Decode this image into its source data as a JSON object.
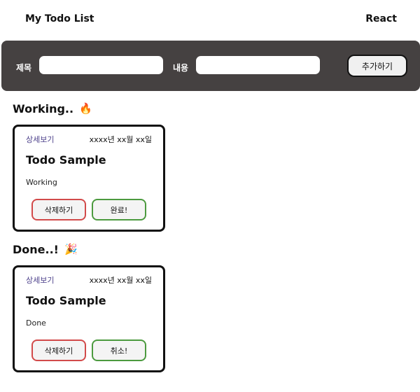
{
  "header": {
    "title": "My Todo List",
    "brand": "React"
  },
  "form": {
    "title_label": "제목",
    "content_label": "내용",
    "title_value": "",
    "content_value": "",
    "add_button": "추가하기"
  },
  "sections": {
    "working": {
      "title": "Working..",
      "emoji": "🔥"
    },
    "done": {
      "title": "Done..!",
      "emoji": "🎉"
    }
  },
  "cards": {
    "working": {
      "detail_link": "상세보기",
      "date": "xxxx년 xx월 xx일",
      "title": "Todo Sample",
      "body": "Working",
      "delete_button": "삭제하기",
      "toggle_button": "완료!"
    },
    "done": {
      "detail_link": "상세보기",
      "date": "xxxx년 xx월 xx일",
      "title": "Todo Sample",
      "body": "Done",
      "delete_button": "삭제하기",
      "toggle_button": "취소!"
    }
  },
  "colors": {
    "form_bar_bg": "#454141",
    "delete_border": "#d24a4a",
    "toggle_border": "#4c9a3f",
    "link": "#4b3f8a"
  }
}
